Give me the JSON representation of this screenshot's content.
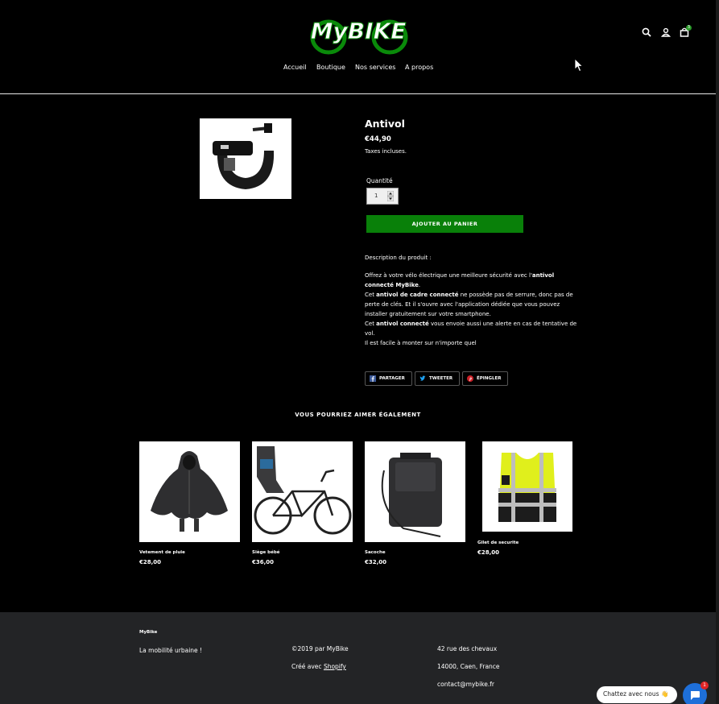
{
  "header": {
    "logo_text": "MyBIKE",
    "nav": [
      "Accueil",
      "Boutique",
      "Nos services",
      "A propos"
    ],
    "cart_count": "3"
  },
  "product": {
    "title": "Antivol",
    "price": "€44,90",
    "tax_note": "Taxes incluses.",
    "quantity_label": "Quantité",
    "quantity": "1",
    "add_to_cart": "AJOUTER AU PANIER",
    "description_title": "Description du produit :",
    "description": {
      "p1_pre": "Offrez à votre vélo électrique une meilleure sécurité avec l'",
      "p1_bold": "antivol connecté MyBike",
      "p1_post": ".",
      "p2_pre": "Cet ",
      "p2_bold": "antivol de cadre connecté",
      "p2_post": " ne possède pas de serrure, donc pas de perte de clés. Et il s'ouvre avec l'application dédiée que vous pouvez installer gratuitement sur votre smartphone.",
      "p3_pre": "Cet ",
      "p3_bold": "antivol connecté",
      "p3_post": " vous envoie aussi une alerte en cas de tentative de vol.",
      "p4": "Il est facile à monter sur n'importe quel"
    },
    "share": [
      "PARTAGER",
      "TWEETER",
      "ÉPINGLER"
    ]
  },
  "related": {
    "heading": "VOUS POURRIEZ AIMER ÉGALEMENT",
    "items": [
      {
        "title": "Vetement de pluie",
        "price": "€28,00"
      },
      {
        "title": "Siège bébé",
        "price": "€36,00"
      },
      {
        "title": "Sacoche",
        "price": "€32,00"
      },
      {
        "title": "Gilet de securite",
        "price": "€28,00"
      }
    ]
  },
  "footer": {
    "brand": "MyBike",
    "tagline": "La mobilité urbaine !",
    "copyright": "©2019 par MyBike",
    "created_pre": "Créé avec ",
    "created_link": "Shopify",
    "address1": "42 rue des chevaux",
    "address2": "14000, Caen, France",
    "email": "contact@mybike.fr"
  },
  "chat": {
    "label": "Chattez avec nous 👋",
    "badge": "1"
  },
  "colors": {
    "background": "#000000",
    "accent_green": "#098009",
    "footer_bg": "#232426",
    "chat_blue": "#1e6fd9"
  }
}
